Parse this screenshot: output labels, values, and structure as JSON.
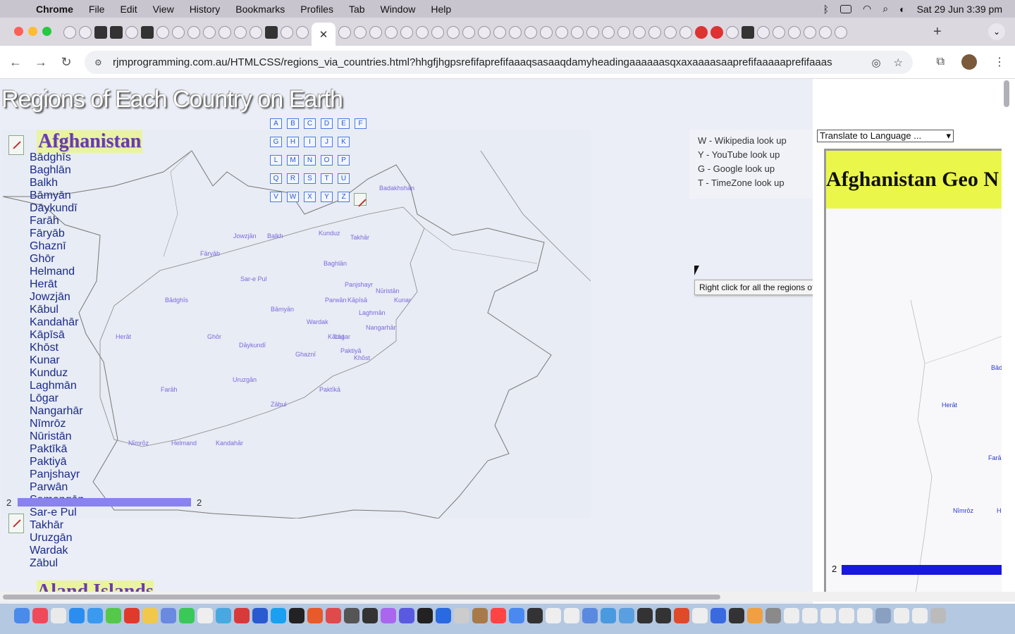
{
  "menubar": {
    "app": "Chrome",
    "items": [
      "File",
      "Edit",
      "View",
      "History",
      "Bookmarks",
      "Profiles",
      "Tab",
      "Window",
      "Help"
    ],
    "datetime": "Sat 29 Jun  3:39 pm"
  },
  "tabs": {
    "active_close": "✕",
    "new_tab": "+",
    "menu": "⌄"
  },
  "toolbar": {
    "url": "rjmprogramming.com.au/HTMLCSS/regions_via_countries.html?hhgfjhgpsrefifaprefifaaaqsasaaqdamyheadingaaaaaasqxaxaaaasaaprefifaaaaaprefifaaas"
  },
  "page": {
    "title": "Regions of Each Country on Earth",
    "country": "Afghanistan",
    "regions": [
      "Bādghīs",
      "Baghlān",
      "Balkh",
      "Bāmyān",
      "Dāykundī",
      "Farāh",
      "Fāryāb",
      "Ghaznī",
      "Ghōr",
      "Helmand",
      "Herāt",
      "Jowzjān",
      "Kābul",
      "Kandahār",
      "Kāpīsā",
      "Khōst",
      "Kunar",
      "Kunduz",
      "Laghmān",
      "Lōgar",
      "Nangarhār",
      "Nīmrōz",
      "Nūristān",
      "Paktīkā",
      "Paktiyā",
      "Panjshayr",
      "Parwān",
      "Samangān",
      "Sar-e Pul",
      "Takhār",
      "Uruzgān",
      "Wardak",
      "Zābul"
    ],
    "letters": [
      "A",
      "B",
      "C",
      "D",
      "E",
      "F",
      "G",
      "H",
      "I",
      "J",
      "K",
      "L",
      "M",
      "N",
      "O",
      "P",
      "Q",
      "R",
      "S",
      "T",
      "U",
      "V",
      "W",
      "X",
      "Y",
      "Z"
    ],
    "map_labels": [
      "Badakhshān",
      "Jowzjān",
      "Balkh",
      "Kunduz",
      "Takhār",
      "Fāryāb",
      "Baghlān",
      "Sar-e Pul",
      "Panjshayr",
      "Nūristān",
      "Bādghīs",
      "Parwān",
      "Kāpīsā",
      "Kunar",
      "Bāmyān",
      "Laghmān",
      "Wardak",
      "Nangarhār",
      "Herāt",
      "Ghōr",
      "Dāykundī",
      "Kābul",
      "Lōgar",
      "Paktiyā",
      "Ghaznī",
      "Khōst",
      "Farāh",
      "Uruzgān",
      "Paktīkā",
      "Zābul",
      "Nīmrōz",
      "Helmand",
      "Kandahār"
    ],
    "legend": [
      "W - Wikipedia look up",
      "Y - YouTube look up",
      "G - Google look up",
      "T - TimeZone look up"
    ],
    "tooltip": "Right click for all the regions of Each Country on Earth",
    "progress_left_label": "2",
    "progress_right_label": "2",
    "next_country": "Aland Islands"
  },
  "right_panel": {
    "translate_select": "Translate to Language ...",
    "geo_heading": "Afghanistan Geo N",
    "labels": [
      "Bād",
      "Herāt",
      "Farāh",
      "Nīmrōz",
      "He"
    ],
    "bar_label": "2"
  },
  "colors": {
    "page_bg": "#ebeef6",
    "heading_bg": "#eaf4a0",
    "heading_text": "#6a3ab0",
    "region_text": "#1a2a8a",
    "progress_left": "#8a82ee",
    "progress_right": "#1818e0",
    "geo_heading_bg": "#eaf74a"
  }
}
